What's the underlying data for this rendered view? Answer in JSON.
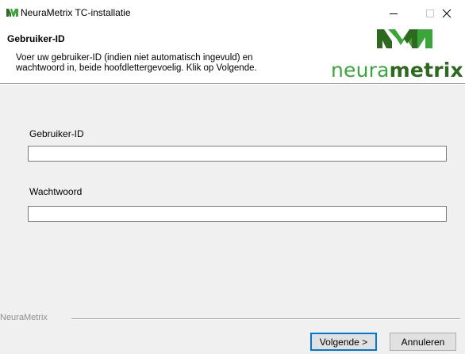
{
  "window": {
    "title": "NeuraMetrix TC-installatie",
    "controls": {
      "minimize_icon": "minimize-icon",
      "maximize_icon": "maximize-icon",
      "close_icon": "close-icon"
    }
  },
  "header": {
    "title": "Gebruiker-ID",
    "description_lines": [
      "Voer uw gebruiker-ID (indien niet automatisch ingevuld) en",
      "wachtwoord in, beide hoofdlettergevoelig. Klik op Volgende."
    ],
    "logo": {
      "mark_icon": "neurametrix-nm-logo",
      "word_part1": "neura",
      "word_part2": "metrix",
      "color_light": "#3aa63a",
      "color_dark": "#2d6a1f"
    }
  },
  "form": {
    "user_id_label": "Gebruiker-ID",
    "user_id_value": "",
    "password_label": "Wachtwoord",
    "password_value": ""
  },
  "footer": {
    "brand": "NeuraMetrix",
    "next_label": "Volgende >",
    "cancel_label": "Annuleren"
  },
  "colors": {
    "body_background": "#f0f0f0",
    "focus_accent": "#0078d7"
  }
}
